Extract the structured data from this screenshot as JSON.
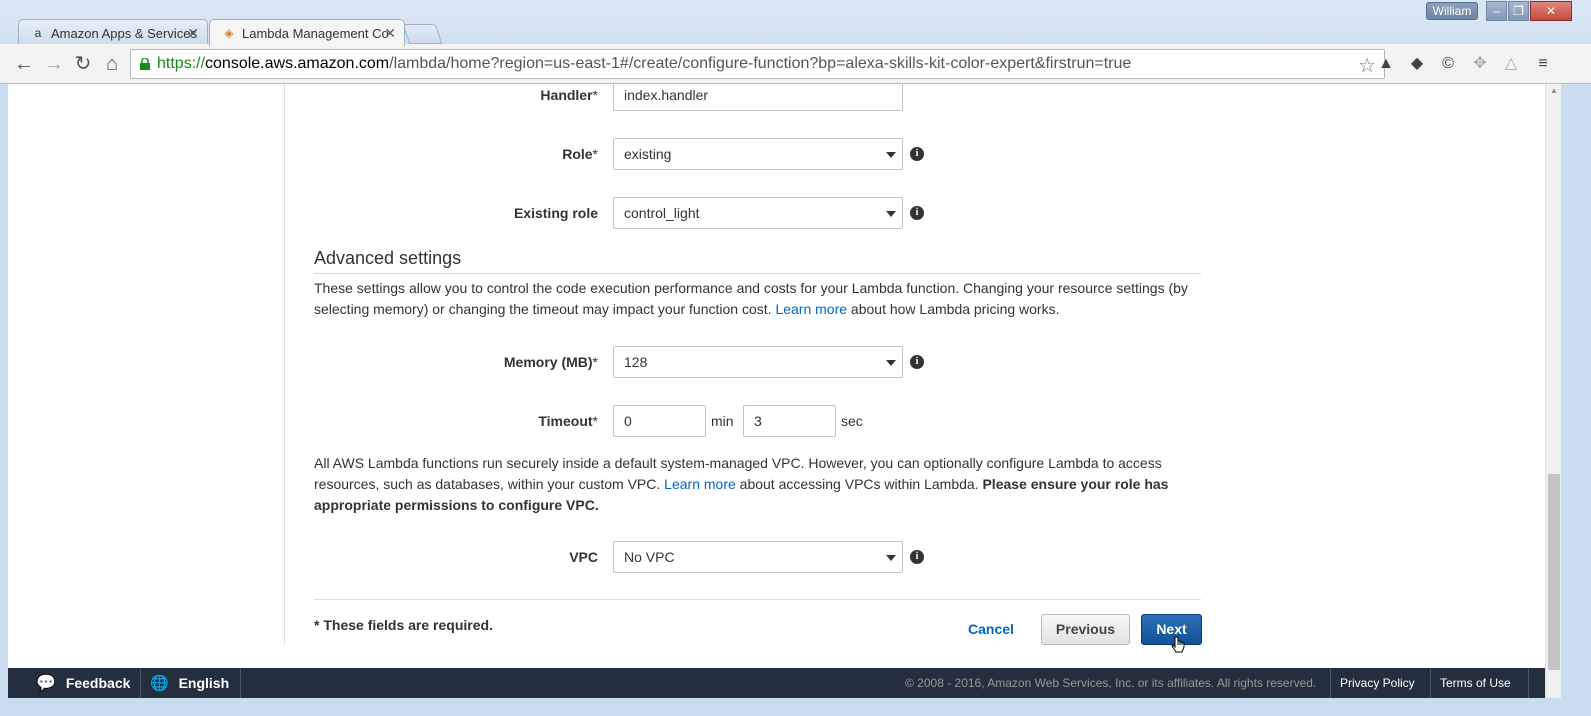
{
  "browser": {
    "tabs": [
      {
        "label": "Amazon Apps & Services"
      },
      {
        "label": "Lambda Management Co"
      }
    ],
    "user_label": "William",
    "url": {
      "scheme": "https://",
      "host": "console.aws.amazon.com",
      "path": "/lambda/home?region=us-east-1#/create/configure-function?bp=alexa-skills-kit-color-expert&firstrun=true"
    }
  },
  "form": {
    "handler": {
      "label": "Handler",
      "value": "index.handler"
    },
    "role": {
      "label": "Role",
      "value": "existing"
    },
    "existing_role": {
      "label": "Existing role",
      "value": "control_light"
    },
    "advanced": {
      "title": "Advanced settings",
      "desc_part1": "These settings allow you to control the code execution performance and costs for your Lambda function. Changing your resource settings (by selecting memory) or changing the timeout may impact your function cost.",
      "desc_link": "Learn more",
      "desc_part2": "about how Lambda pricing works."
    },
    "memory": {
      "label": "Memory (MB)",
      "value": "128"
    },
    "timeout": {
      "label": "Timeout",
      "min_value": "0",
      "min_unit": "min",
      "sec_value": "3",
      "sec_unit": "sec"
    },
    "vpc_note": {
      "part1": "All AWS Lambda functions run securely inside a default system-managed VPC. However, you can optionally configure Lambda to access resources, such as databases, within your custom VPC.",
      "link": "Learn more",
      "part2": "about accessing VPCs within Lambda.",
      "bold": "Please ensure your role has appropriate permissions to configure VPC."
    },
    "vpc": {
      "label": "VPC",
      "value": "No VPC"
    },
    "required_note": "* These fields are required.",
    "buttons": {
      "cancel": "Cancel",
      "previous": "Previous",
      "next": "Next"
    }
  },
  "footer": {
    "feedback": "Feedback",
    "language": "English",
    "copyright": "© 2008 - 2016, Amazon Web Services, Inc. or its affiliates. All rights reserved.",
    "privacy": "Privacy Policy",
    "terms": "Terms of Use"
  },
  "colors": {
    "accent": "#0066c0",
    "next_button": "#125198",
    "footer_bg": "#232f3e"
  }
}
